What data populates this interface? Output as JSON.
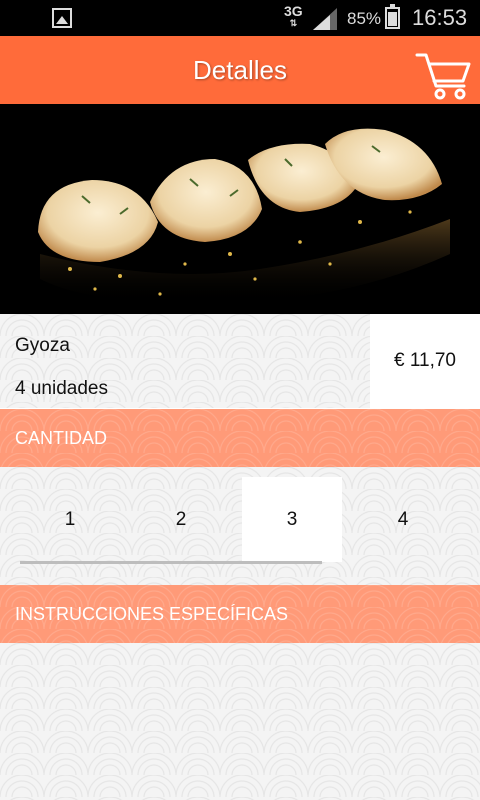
{
  "status_bar": {
    "network": "3G",
    "battery_pct": "85%",
    "time": "16:53",
    "icons": [
      "gallery-icon",
      "signal-icon",
      "battery-icon"
    ]
  },
  "app_bar": {
    "title": "Detalles",
    "cart_icon": "cart-icon",
    "color": "#ff6b3a"
  },
  "product": {
    "name": "Gyoza",
    "units": "4 unidades",
    "price": "€ 11,70"
  },
  "quantity": {
    "header": "CANTIDAD",
    "options": [
      "1",
      "2",
      "3",
      "4"
    ],
    "selected": "3"
  },
  "instructions": {
    "header": "INSTRUCCIONES ESPECÍFICAS",
    "value": ""
  },
  "colors": {
    "accent": "#ff6b3a",
    "section_header": "#ff9a78"
  }
}
